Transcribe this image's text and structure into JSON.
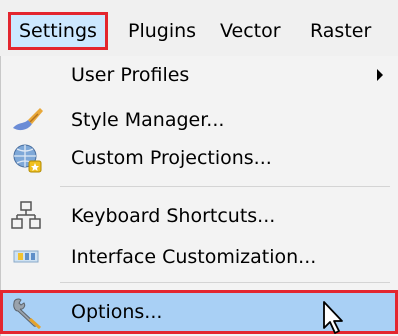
{
  "menubar": {
    "items": [
      {
        "label": "Settings"
      },
      {
        "label": "Plugins"
      },
      {
        "label": "Vector"
      },
      {
        "label": "Raster"
      }
    ]
  },
  "settings_menu": {
    "items": [
      {
        "label": "User Profiles",
        "icon": "none",
        "submenu": true
      },
      {
        "label": "Style Manager...",
        "icon": "paintbrush-icon"
      },
      {
        "label": "Custom Projections...",
        "icon": "globe-star-icon"
      },
      {
        "label": "Keyboard Shortcuts...",
        "icon": "shortcut-tree-icon"
      },
      {
        "label": "Interface Customization...",
        "icon": "interface-customization-icon"
      },
      {
        "label": "Options...",
        "icon": "wrench-icon",
        "highlighted": true
      }
    ]
  },
  "colors": {
    "highlight_fill": "#a9d0f5",
    "annotation_border": "#e3262f",
    "menu_bg": "#f3f3f3"
  }
}
